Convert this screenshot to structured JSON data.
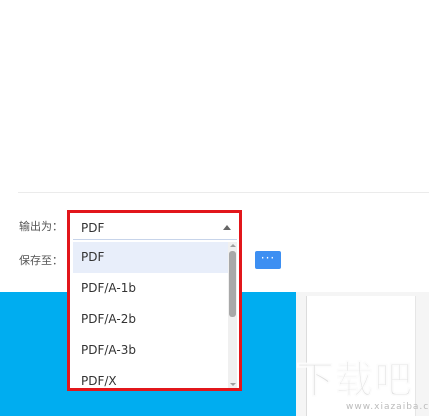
{
  "form": {
    "output_label": "输出为：",
    "save_label": "保存至：",
    "browse_button_label": "···"
  },
  "format_select": {
    "value": "PDF",
    "options": [
      "PDF",
      "PDF/A-1b",
      "PDF/A-2b",
      "PDF/A-3b",
      "PDF/X"
    ],
    "selected_index": 0
  },
  "watermark": {
    "logo_text": "下载吧",
    "url": "www.xiazaiba.com"
  },
  "colors": {
    "highlight_border": "#e2161b",
    "accent_blue": "#3d8ff2",
    "background_blue": "#00adf0",
    "selected_option_bg": "#e8eefa"
  },
  "icons": {
    "dropdown_arrow": "caret-up-icon",
    "browse": "more-dots-icon"
  }
}
